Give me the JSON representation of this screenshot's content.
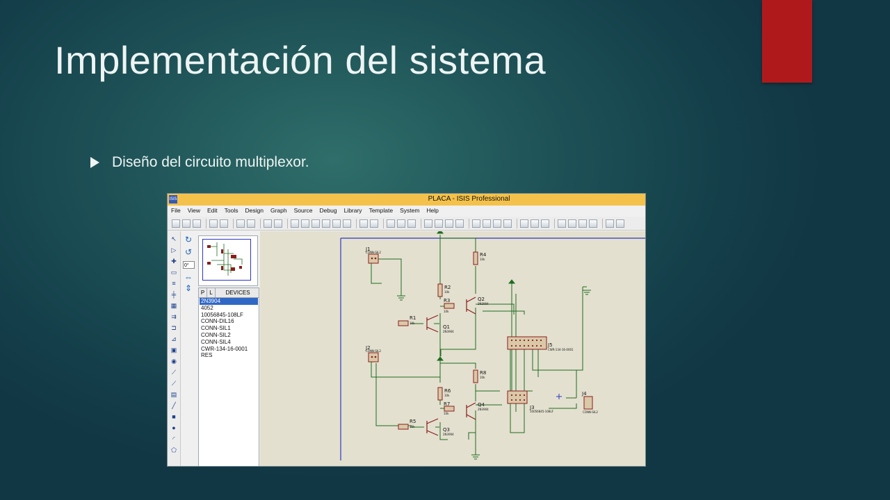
{
  "slide": {
    "title": "Implementación del sistema",
    "bullet": "Diseño del circuito multiplexor.",
    "accent_color": "#b0191b"
  },
  "window": {
    "title": "PLACA - ISIS Professional",
    "app_icon": "ISIS"
  },
  "menu": [
    "File",
    "View",
    "Edit",
    "Tools",
    "Design",
    "Graph",
    "Source",
    "Debug",
    "Library",
    "Template",
    "System",
    "Help"
  ],
  "rotation": {
    "angle": "0°"
  },
  "devices": {
    "tab_p": "P",
    "tab_l": "L",
    "header": "DEVICES",
    "items": [
      "2N3904",
      "4052",
      "10056845-108LF",
      "CONN-DIL16",
      "CONN-SIL1",
      "CONN-SIL2",
      "CONN-SIL4",
      "CWR-134-16-0001",
      "RES"
    ],
    "selected": "2N3904"
  },
  "schematic": {
    "placeholder": "<TEXT>",
    "connectors": [
      {
        "ref": "J1",
        "value": "CONN-SIL2"
      },
      {
        "ref": "J2",
        "value": "CONN-SIL2"
      },
      {
        "ref": "J3",
        "value": "10056845-108LF"
      },
      {
        "ref": "J4",
        "value": "CONN-SIL2"
      },
      {
        "ref": "J5",
        "value": "CWR-134-16-0001"
      }
    ],
    "resistors": [
      {
        "ref": "R1",
        "value": "10k"
      },
      {
        "ref": "R2",
        "value": "10k"
      },
      {
        "ref": "R3",
        "value": "10k"
      },
      {
        "ref": "R4",
        "value": "10k"
      },
      {
        "ref": "R5",
        "value": "10k"
      },
      {
        "ref": "R6",
        "value": "10k"
      },
      {
        "ref": "R7",
        "value": "10k"
      },
      {
        "ref": "R8",
        "value": "10k"
      }
    ],
    "transistors": [
      {
        "ref": "Q1",
        "value": "2N3904"
      },
      {
        "ref": "Q2",
        "value": "2N3904"
      },
      {
        "ref": "Q3",
        "value": "2N3904"
      },
      {
        "ref": "Q4",
        "value": "2N3904"
      }
    ],
    "colors": {
      "wire": "#1f6b1f",
      "component": "#8b1c1c",
      "component_fill": "#d9c9a8",
      "sheet_border": "#2c36c4",
      "background": "#e3e0cf"
    }
  }
}
